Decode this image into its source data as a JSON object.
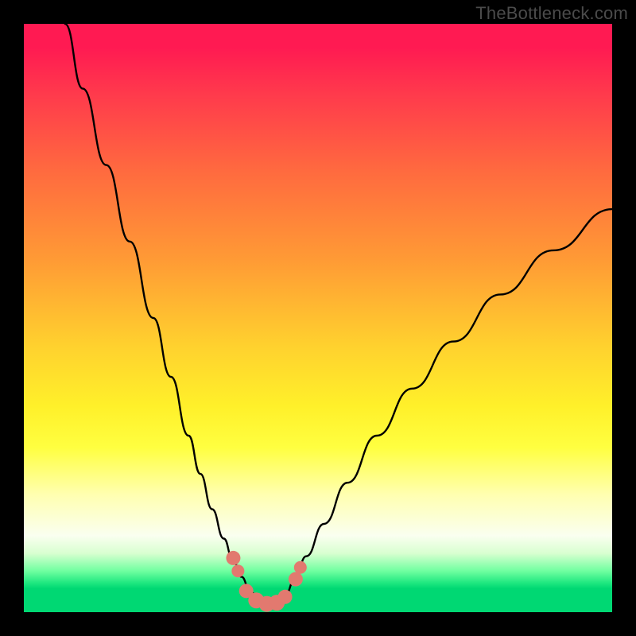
{
  "watermark": "TheBottleneck.com",
  "chart_data": {
    "type": "line",
    "title": "",
    "xlabel": "",
    "ylabel": "",
    "xlim": [
      0,
      100
    ],
    "ylim": [
      0,
      100
    ],
    "series": [
      {
        "name": "curve-left",
        "x": [
          7,
          10,
          14,
          18,
          22,
          25,
          28,
          30,
          32,
          34,
          35.5,
          37,
          38.5,
          40,
          41.5
        ],
        "y": [
          100,
          89,
          76,
          63,
          50,
          40,
          30,
          23.5,
          17.5,
          12.5,
          9,
          6,
          3.5,
          1.8,
          1
        ]
      },
      {
        "name": "curve-right",
        "x": [
          41.5,
          43,
          44.5,
          46,
          48,
          51,
          55,
          60,
          66,
          73,
          81,
          90,
          100
        ],
        "y": [
          1,
          1.5,
          3,
          5.5,
          9.5,
          15,
          22,
          30,
          38,
          46,
          54,
          61.5,
          68.5
        ]
      }
    ],
    "markers": {
      "name": "data-points",
      "color": "#e2796f",
      "points": [
        {
          "x": 35.6,
          "y": 9.2,
          "r": 9
        },
        {
          "x": 36.4,
          "y": 7.0,
          "r": 8
        },
        {
          "x": 37.8,
          "y": 3.6,
          "r": 9
        },
        {
          "x": 39.5,
          "y": 2.0,
          "r": 10
        },
        {
          "x": 41.3,
          "y": 1.4,
          "r": 10
        },
        {
          "x": 43.0,
          "y": 1.6,
          "r": 10
        },
        {
          "x": 44.4,
          "y": 2.6,
          "r": 9
        },
        {
          "x": 46.2,
          "y": 5.6,
          "r": 9
        },
        {
          "x": 47.0,
          "y": 7.6,
          "r": 8
        }
      ]
    }
  }
}
